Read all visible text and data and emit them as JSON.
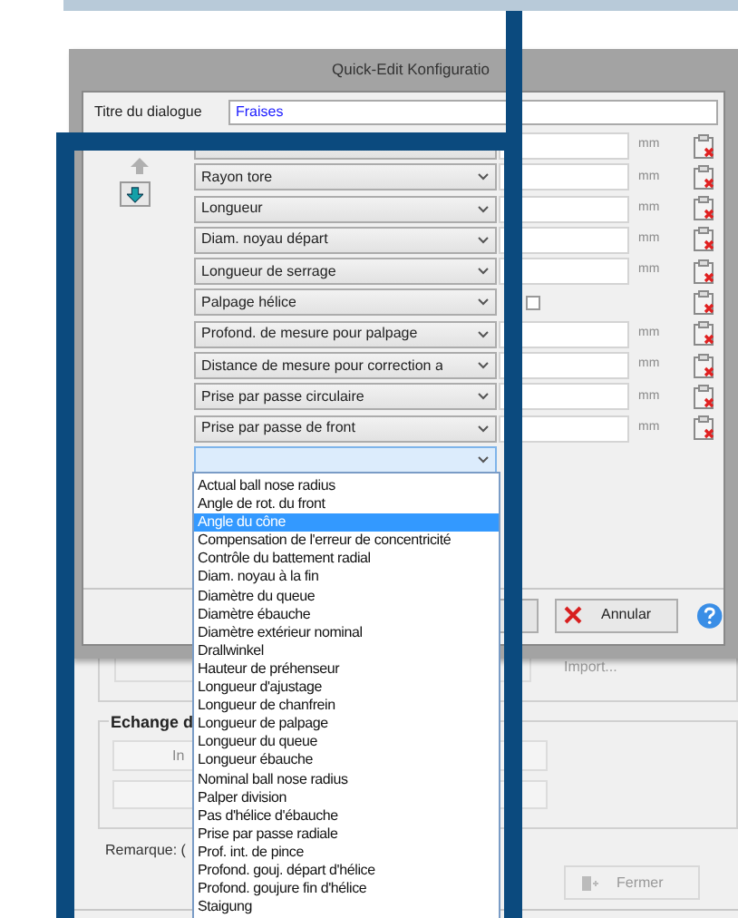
{
  "dialog": {
    "title": "Quick-Edit Konfiguratio",
    "title_label": "Titre du dialogue",
    "title_value": "Fraises",
    "move_up": {
      "disabled": true
    },
    "move_down": {
      "disabled": false
    },
    "rows": [
      {
        "kind": "measure",
        "unit": "mm"
      },
      {
        "kind": "measure",
        "parameter": "Rayon tore",
        "unit": "mm"
      },
      {
        "kind": "measure",
        "parameter": "Longueur",
        "unit": "mm"
      },
      {
        "kind": "measure",
        "parameter": "Diam. noyau départ",
        "unit": "mm"
      },
      {
        "kind": "measure",
        "parameter": "Longueur de serrage",
        "unit": "mm"
      },
      {
        "kind": "toggle",
        "parameter": "Palpage hélice",
        "checked": false
      },
      {
        "kind": "measure",
        "parameter": "Profond. de mesure pour palpage",
        "unit": "mm"
      },
      {
        "kind": "measure",
        "parameter": "Distance de mesure pour correction a",
        "unit": "mm"
      },
      {
        "kind": "measure",
        "parameter": "Prise par passe circulaire",
        "unit": "mm"
      },
      {
        "kind": "measure",
        "parameter": "Prise par passe de front",
        "unit": "mm"
      },
      {
        "kind": "new",
        "open": true
      }
    ],
    "dropdown": [
      {
        "label": "Actual ball nose radius",
        "selected": false
      },
      {
        "label": "Angle de rot. du front",
        "selected": false
      },
      {
        "label": "Angle du cône",
        "selected": true
      },
      {
        "label": "Compensation de l'erreur de concentricité",
        "selected": false
      },
      {
        "label": "Contrôle du battement radial",
        "selected": false
      },
      {
        "label": "Diam. noyau à la fin",
        "selected": false
      },
      {
        "label": "Diamètre du queue",
        "selected": false
      },
      {
        "label": "Diamètre ébauche",
        "selected": false
      },
      {
        "label": "Diamètre extérieur nominal",
        "selected": false
      },
      {
        "label": "Drallwinkel",
        "selected": false
      },
      {
        "label": "Hauteur de préhenseur",
        "selected": false
      },
      {
        "label": "Longueur d'ajustage",
        "selected": false
      },
      {
        "label": "Longueur de chanfrein",
        "selected": false
      },
      {
        "label": "Longueur de palpage",
        "selected": false
      },
      {
        "label": "Longueur du queue",
        "selected": false
      },
      {
        "label": "Longueur ébauche",
        "selected": false
      },
      {
        "label": "Nominal ball nose radius",
        "selected": false
      },
      {
        "label": "Palper division",
        "selected": false
      },
      {
        "label": "Pas d'hélice d'ébauche",
        "selected": false
      },
      {
        "label": "Prise par passe radiale",
        "selected": false
      },
      {
        "label": "Prof. int. de pince",
        "selected": false
      },
      {
        "label": "Profond. gouj. départ d'hélice",
        "selected": false
      },
      {
        "label": "Profond. goujure fin d'hélice",
        "selected": false
      },
      {
        "label": "Staigung",
        "selected": false
      }
    ],
    "cancel_button": "Annular"
  },
  "background_window": {
    "import_label": "Import...",
    "group_title": "Echange d",
    "field_text": "In",
    "remark": "Remarque: (",
    "close_button": {
      "label": "Fermer",
      "disabled": true
    }
  }
}
